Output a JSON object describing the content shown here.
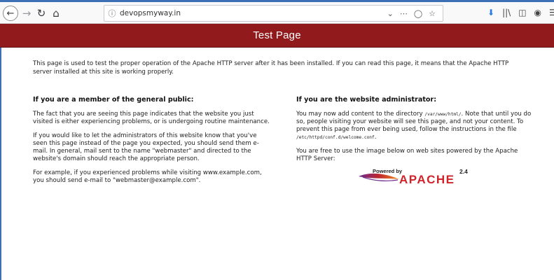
{
  "browser": {
    "url": "devopsmyway.in",
    "icons": [
      "back-arrow-icon",
      "forward-arrow-icon",
      "reload-icon",
      "home-icon",
      "info-icon",
      "dropdown-chevron-icon",
      "page-actions-icon",
      "pocket-icon",
      "bookmark-star-icon",
      "download-icon",
      "library-icon",
      "sidebar-icon",
      "account-icon",
      "menu-icon"
    ]
  },
  "page": {
    "title": "Test Page",
    "intro": "This page is used to test the proper operation of the Apache HTTP server after it has been installed. If you can read this page, it means that the Apache HTTP server installed at this site is working properly.",
    "left": {
      "heading": "If you are a member of the general public:",
      "p1": "The fact that you are seeing this page indicates that the website you just visited is either experiencing problems, or is undergoing routine maintenance.",
      "p2": "If you would like to let the administrators of this website know that you've seen this page instead of the page you expected, you should send them e-mail. In general, mail sent to the name \"webmaster\" and directed to the website's domain should reach the appropriate person.",
      "p3": "For example, if you experienced problems while visiting www.example.com, you should send e-mail to \"webmaster@example.com\"."
    },
    "right": {
      "heading": "If you are the website administrator:",
      "p1_a": "You may now add content to the directory ",
      "p1_code1": "/var/www/html/",
      "p1_b": ". Note that until you do so, people visiting your website will see this page, and not your content. To prevent this page from ever being used, follow the instructions in the file ",
      "p1_code2": "/etc/httpd/conf.d/welcome.conf",
      "p1_c": ".",
      "p2": "You are free to use the image below on web sites powered by the Apache HTTP Server:"
    },
    "logo": {
      "powered_by": "Powered by",
      "apache": "APACHE",
      "version": "2.4",
      "colors": {
        "red": "#d1232a",
        "purple": "#6b2c8e",
        "orange": "#f29222"
      }
    }
  },
  "colors": {
    "banner": "#901a1c",
    "accent": "#3d6fb7"
  }
}
